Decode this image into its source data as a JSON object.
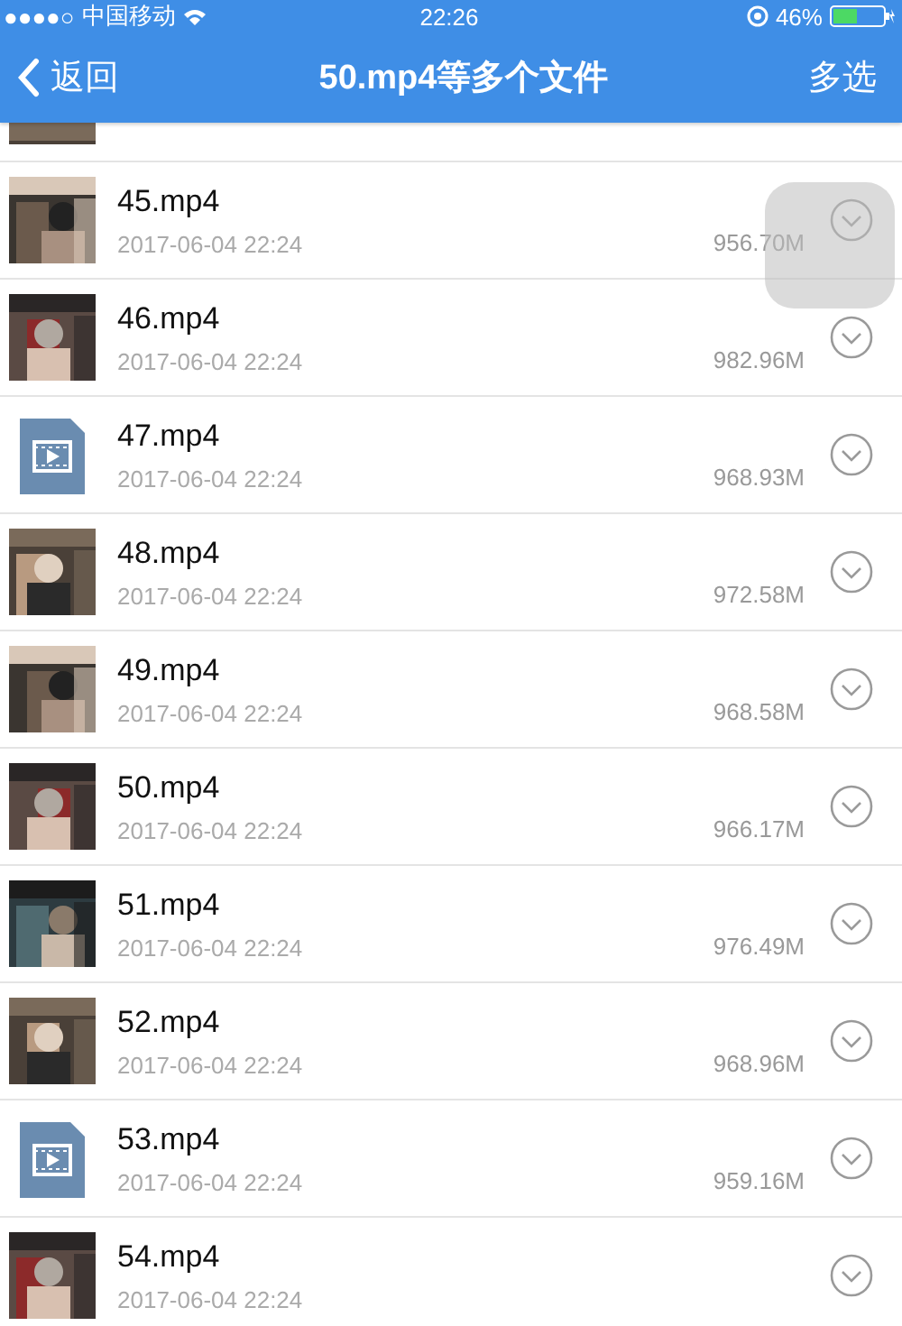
{
  "status_bar": {
    "signal_dots": "●●●●○",
    "carrier": "中国移动",
    "time": "22:26",
    "battery": "46%"
  },
  "nav": {
    "back": "返回",
    "title": "50.mp4等多个文件",
    "action": "多选"
  },
  "partial_row": {
    "kind": "video"
  },
  "files": [
    {
      "kind": "video",
      "name": "45.mp4",
      "date": "2017-06-04 22:24",
      "size": "956.70M"
    },
    {
      "kind": "video",
      "name": "46.mp4",
      "date": "2017-06-04 22:24",
      "size": "982.96M"
    },
    {
      "kind": "file",
      "name": "47.mp4",
      "date": "2017-06-04 22:24",
      "size": "968.93M"
    },
    {
      "kind": "video",
      "name": "48.mp4",
      "date": "2017-06-04 22:24",
      "size": "972.58M"
    },
    {
      "kind": "video",
      "name": "49.mp4",
      "date": "2017-06-04 22:24",
      "size": "968.58M"
    },
    {
      "kind": "video",
      "name": "50.mp4",
      "date": "2017-06-04 22:24",
      "size": "966.17M"
    },
    {
      "kind": "video",
      "name": "51.mp4",
      "date": "2017-06-04 22:24",
      "size": "976.49M"
    },
    {
      "kind": "video",
      "name": "52.mp4",
      "date": "2017-06-04 22:24",
      "size": "968.96M"
    },
    {
      "kind": "file",
      "name": "53.mp4",
      "date": "2017-06-04 22:24",
      "size": "959.16M"
    },
    {
      "kind": "video",
      "name": "54.mp4",
      "date": "2017-06-04 22:24"
    }
  ]
}
